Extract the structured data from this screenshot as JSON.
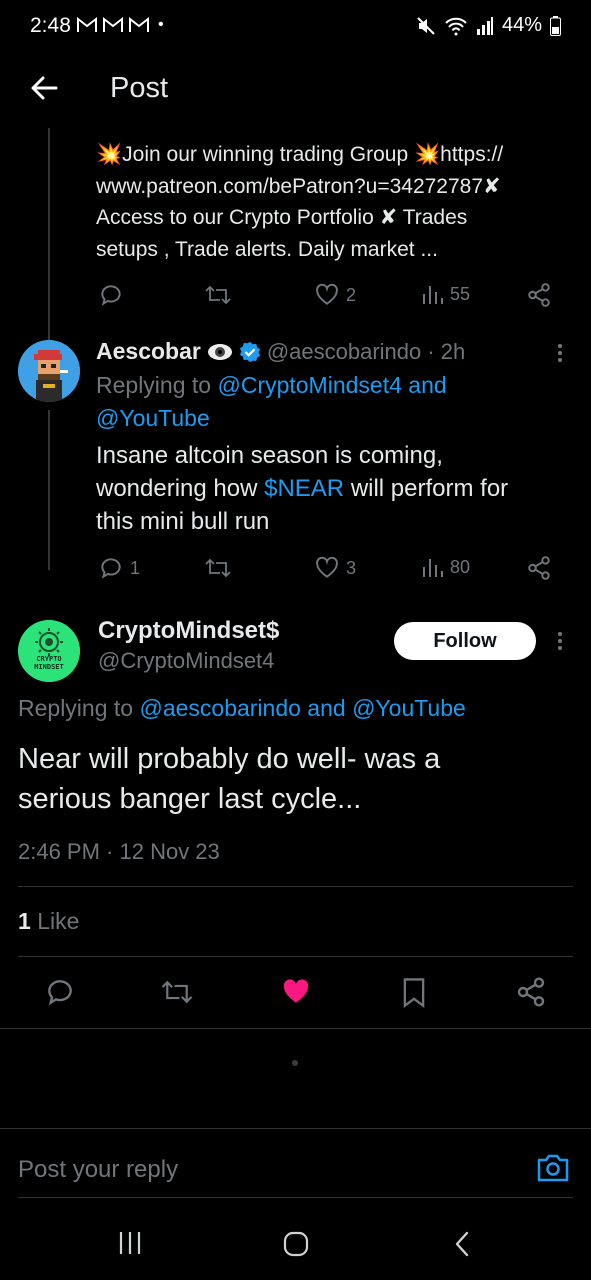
{
  "status_bar": {
    "time": "2:48",
    "notification_icons": "M M M •",
    "battery": "44%"
  },
  "header": {
    "title": "Post"
  },
  "top_post": {
    "line1": "Join our winning trading Group",
    "line1_end": "https://",
    "line2": "www.patreon.com/bePatron?u=34272787",
    "line3a": "Access to our Crypto Portfolio",
    "line3b": "Trades",
    "line4": "setups , Trade alerts. Daily market ...",
    "likes": "2",
    "views": "55"
  },
  "reply_post": {
    "name": "Aescobar",
    "handle": "@aescobarindo",
    "time": "· 2h",
    "replying_prefix": "Replying to",
    "replying_to_1": "@CryptoMindset4 and",
    "replying_to_2": "@YouTube",
    "text_line1": "Insane altcoin season is coming,",
    "text_line2_a": "wondering how",
    "text_line2_cashtag": "$NEAR",
    "text_line2_b": "will perform for",
    "text_line3": "this mini bull run",
    "replies": "1",
    "likes": "3",
    "views": "80"
  },
  "main_post": {
    "name": "CryptoMindset$",
    "handle": "@CryptoMindset4",
    "avatar_text_1": "CRYPTO",
    "avatar_text_2": "MINDSET",
    "follow_label": "Follow",
    "replying_prefix": "Replying to",
    "replying_to": "@aescobarindo and @YouTube",
    "text_line1": "Near will probably do well- was a",
    "text_line2": "serious banger last cycle...",
    "timestamp": "2:46 PM · 12 Nov 23",
    "like_count": "1",
    "like_label": "Like"
  },
  "reply_bar": {
    "placeholder": "Post your reply"
  },
  "colors": {
    "background": "#000000",
    "text": "#e7e9ea",
    "muted": "#71767b",
    "link": "#1d9bf0",
    "like": "#f91880",
    "verified": "#1d9bf0"
  }
}
